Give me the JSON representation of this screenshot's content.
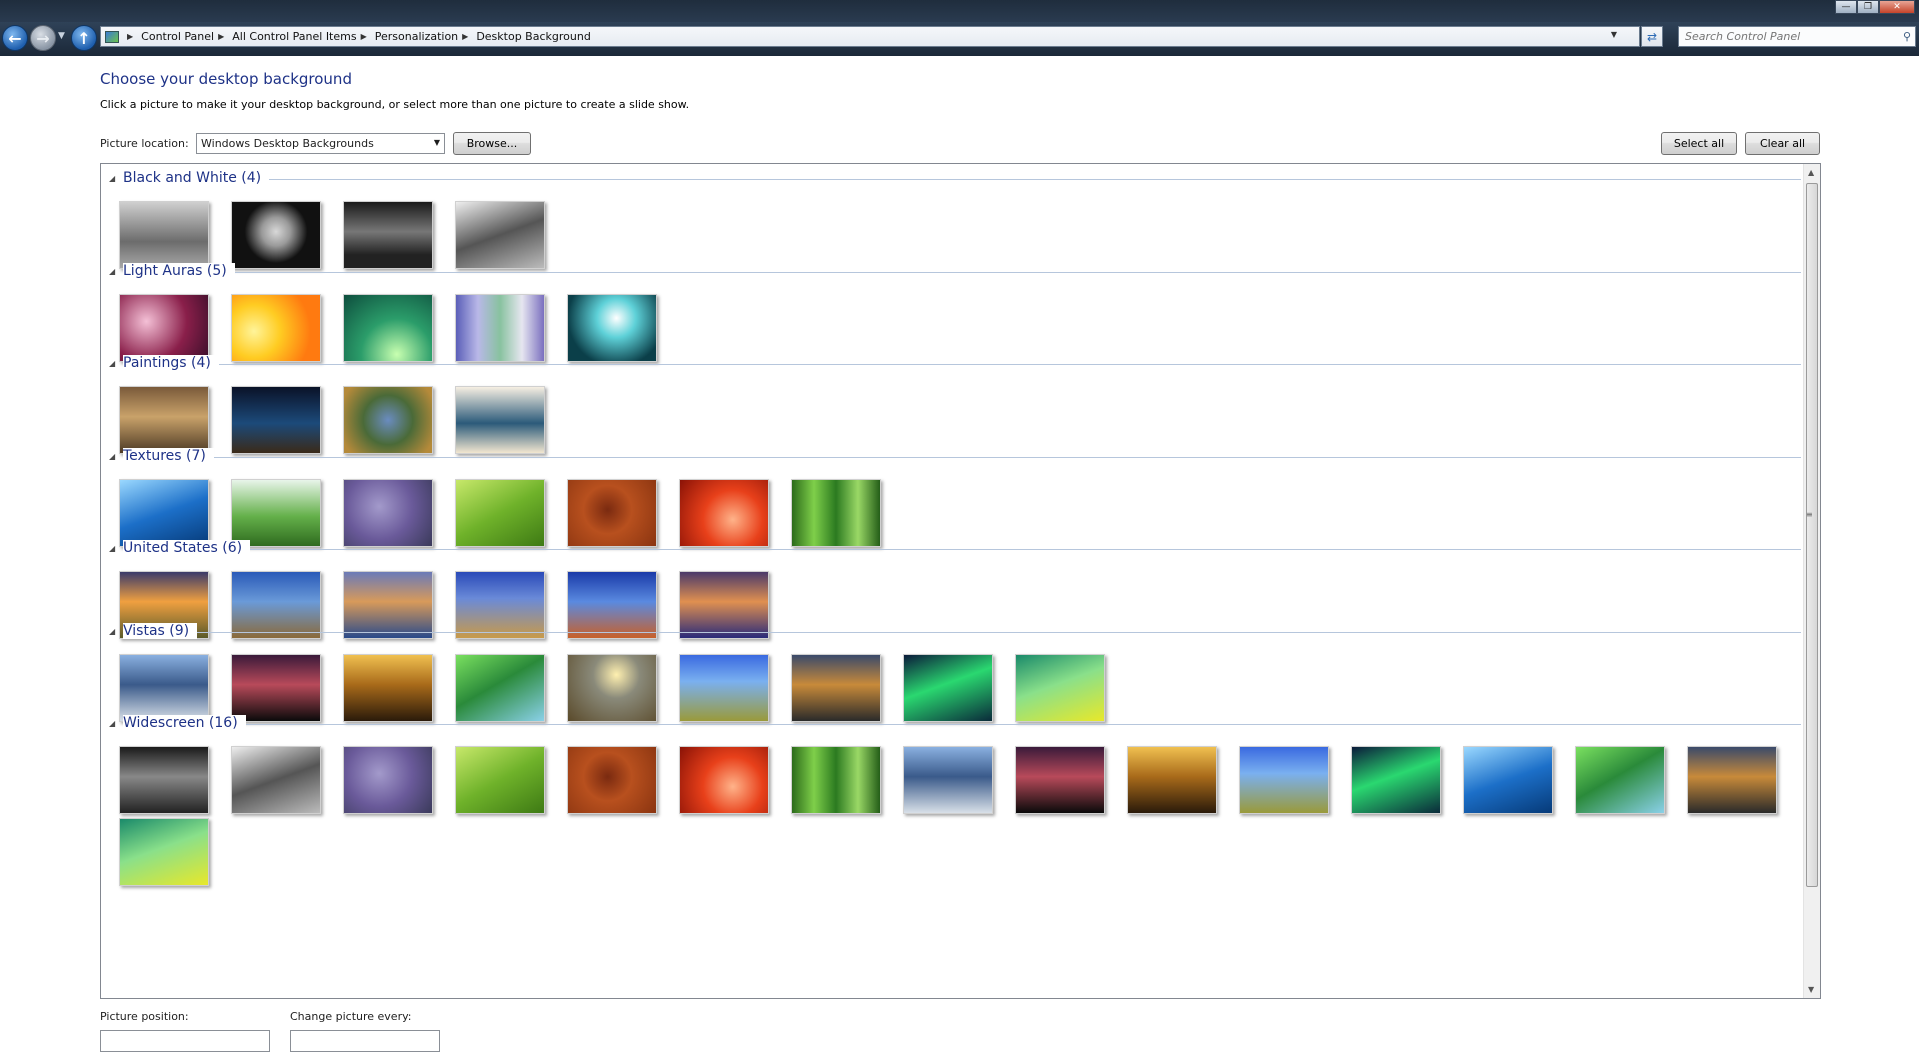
{
  "address_bar": {
    "breadcrumbs": [
      "Control Panel",
      "All Control Panel Items",
      "Personalization",
      "Desktop Background"
    ],
    "search_placeholder": "Search Control Panel"
  },
  "page": {
    "title": "Choose your desktop background",
    "subtitle": "Click a picture to make it your desktop background, or select more than one picture to create a slide show."
  },
  "location": {
    "label": "Picture location:",
    "selected": "Windows Desktop Backgrounds",
    "browse_label": "Browse...",
    "select_all_label": "Select all",
    "clear_all_label": "Clear all"
  },
  "groups": [
    {
      "title": "Black and White (4)",
      "thumbnails": [
        "linear-gradient(180deg,#cfcfcf,#6c6c6c 60%,#a8a8a8)",
        "radial-gradient(circle at 50% 45%,#d8d8d8 0,#9a9a9a 25%,#111 55%)",
        "linear-gradient(180deg,#1a1a1a,#777 45%,#222 80%)",
        "linear-gradient(160deg,#eeeeee,#555 50%,#bbbbbb)"
      ]
    },
    {
      "title": "Light Auras (5)",
      "thumbnails": [
        "radial-gradient(circle at 30% 40%,#f4c0d6,#8a1f4a 55%,#3a0f2a)",
        "radial-gradient(circle at 25% 55%,#fff49a,#ffcc22 35%,#ff7a10 75%)",
        "radial-gradient(circle at 60% 90%,#c8ffb0,#2b9d6a 45%,#0d4d3d)",
        "linear-gradient(90deg,#5b5fb8,#b9b8e8,#88c29f,#e6e6f0,#7a6fbf)",
        "radial-gradient(circle at 55% 35%,#ffffff,#5ed1d8 30%,#0b3f49 75%)"
      ]
    },
    {
      "title": "Paintings (4)",
      "thumbnails": [
        "linear-gradient(180deg,#7a5a3a,#c9a26a 45%,#4d3a25)",
        "linear-gradient(180deg,#0a1228,#1c4a7a 55%,#3a2a18)",
        "radial-gradient(circle at 50% 50%,#6a8cc0,#4a6a38 45%,#b58a3a 90%)",
        "linear-gradient(180deg,#f6efe2,#2b5a7a 55%,#f2e6d0)"
      ]
    },
    {
      "title": "Textures (7)",
      "thumbnails": [
        "linear-gradient(160deg,#9ad8ff,#1c6fc8 50%,#063a78)",
        "linear-gradient(180deg,#e8f5ea,#64b04a 55%,#2f6b1f)",
        "radial-gradient(circle at 40% 40%,#a39acb,#6a5a9a 50%,#3a3a5a)",
        "linear-gradient(150deg,#c7e86a,#6fb22a 50%,#3e7a14)",
        "radial-gradient(circle at 45% 45%,#7a2a10,#b8501e 40%,#8a3410)",
        "radial-gradient(circle at 60% 60%,#ffb38a,#e8401a 45%,#8a1206)",
        "linear-gradient(90deg,#2b6b1a,#7fcf4a,#2b7a20,#9ad866,#245e18)"
      ]
    },
    {
      "title": "United States (6)",
      "thumbnails": [
        "linear-gradient(180deg,#3a3a6a,#f0a040 45%,#5a5a2a)",
        "linear-gradient(180deg,#2a5ab8,#6a9ad8 45%,#8a6a3a)",
        "linear-gradient(180deg,#6a7ab8,#d89a5a 45%,#2a4a8a)",
        "linear-gradient(180deg,#2a4ab8,#6a8ad8 40%,#c89a4a)",
        "linear-gradient(180deg,#1a3aa8,#5a8ae0 45%,#c8602a)",
        "linear-gradient(180deg,#4a3a6a,#e09050 45%,#2a2a7a)"
      ]
    },
    {
      "title": "Vistas (9)",
      "thumbnails": [
        "linear-gradient(180deg,#8ab0e0,#3a5a8a 45%,#d8e0e8)",
        "linear-gradient(180deg,#3a1a3a,#b84a5a 45%,#0a0a0a)",
        "linear-gradient(180deg,#f0c050,#a86a1a 45%,#2a1a0a)",
        "linear-gradient(150deg,#7ae060,#2a8a3a 45%,#8ad0e8)",
        "radial-gradient(circle at 55% 30%,#fff0b0,#8a8a7a 35%,#5a4a2a)",
        "linear-gradient(180deg,#3a6ae0,#7ab0f0 40%,#9a9a3a)",
        "linear-gradient(180deg,#3a4a6a,#c88a3a 45%,#2a2a2a)",
        "linear-gradient(160deg,#0a1a3a,#2ad870 45%,#0a2a3a)",
        "linear-gradient(160deg,#1a8a6a,#8ae08a 45%,#e8e82a)"
      ]
    },
    {
      "title": "Widescreen (16)",
      "thumbnails": [
        "linear-gradient(180deg,#1a1a1a,#888 45%,#222)",
        "linear-gradient(160deg,#eeeeee,#555 50%,#bbbbbb)",
        "radial-gradient(circle at 40% 40%,#a39acb,#6a5a9a 50%,#3a3a5a)",
        "linear-gradient(150deg,#c7e86a,#6fb22a 50%,#3e7a14)",
        "radial-gradient(circle at 45% 45%,#7a2a10,#b8501e 40%,#8a3410)",
        "radial-gradient(circle at 60% 60%,#ffb38a,#e8401a 45%,#8a1206)",
        "linear-gradient(90deg,#2b6b1a,#7fcf4a,#2b7a20,#9ad866,#245e18)",
        "linear-gradient(180deg,#8ab0e0,#3a5a8a 45%,#d8e0e8)",
        "linear-gradient(180deg,#3a1a3a,#b84a5a 45%,#0a0a0a)",
        "linear-gradient(180deg,#f0c050,#a86a1a 45%,#2a1a0a)",
        "linear-gradient(180deg,#3a6ae0,#7ab0f0 40%,#9a9a3a)",
        "linear-gradient(160deg,#0a1a3a,#2ad870 45%,#0a2a3a)",
        "linear-gradient(160deg,#9ad8ff,#1c6fc8 50%,#063a78)",
        "linear-gradient(150deg,#7ae060,#2a8a3a 45%,#8ad0e8)",
        "linear-gradient(180deg,#3a4a6a,#c88a3a 45%,#2a2a2a)",
        "linear-gradient(160deg,#1a8a6a,#8ae08a 45%,#e8e82a)"
      ]
    }
  ],
  "footer": {
    "position_label": "Picture position:",
    "change_label": "Change picture every:"
  },
  "colors": {
    "heading_blue": "#1e3287",
    "group_line": "#b6c6dc"
  },
  "icons": [
    "back-icon",
    "forward-icon",
    "up-icon",
    "control-panel-icon",
    "refresh-icon",
    "search-icon",
    "dropdown-arrow-icon",
    "collapse-triangle-icon"
  ]
}
